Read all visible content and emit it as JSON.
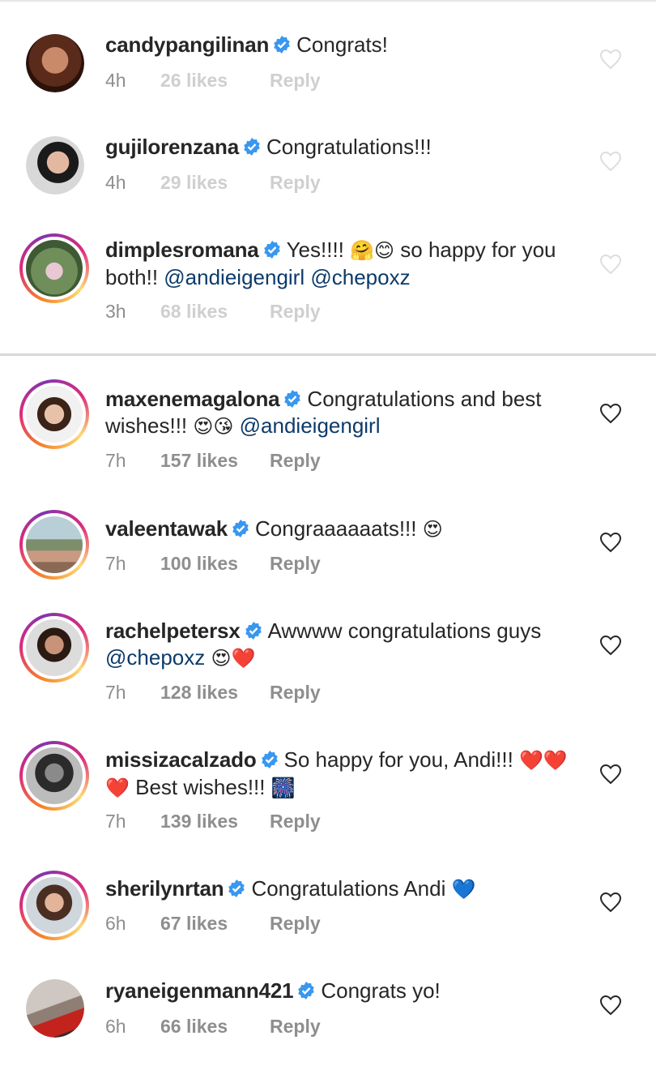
{
  "comments": [
    {
      "username": "candypangilinan",
      "text": "Congrats!",
      "time": "4h",
      "likes": "26 likes",
      "reply": "Reply"
    },
    {
      "username": "gujilorenzana",
      "text": "Congratulations!!!",
      "time": "4h",
      "likes": "29 likes",
      "reply": "Reply"
    },
    {
      "username": "dimplesromana",
      "text_1": "Yes!!!! ",
      "emoji_1": "🤗😊",
      "text_2": " so happy for you both!! ",
      "mention_1": "@andieigengirl",
      "mention_2": "@chepoxz",
      "time": "3h",
      "likes": "68 likes",
      "reply": "Reply"
    },
    {
      "username": "maxenemagalona",
      "text_1": "Congratulations and best wishes!!! ",
      "emoji_1": "😍😘",
      "mention_1": "@andieigengirl",
      "time": "7h",
      "likes": "157 likes",
      "reply": "Reply"
    },
    {
      "username": "valeentawak",
      "text_1": "Congraaaaaats!!! ",
      "emoji_1": "😍",
      "time": "7h",
      "likes": "100 likes",
      "reply": "Reply"
    },
    {
      "username": "rachelpetersx",
      "text_1": "Awwww congratulations guys ",
      "mention_1": "@chepoxz",
      "emoji_1": "😍❤️",
      "time": "7h",
      "likes": "128 likes",
      "reply": "Reply"
    },
    {
      "username": "missizacalzado",
      "text_1": "So happy for you, Andi!!! ",
      "emoji_1": "❤️❤️❤️",
      "text_2": " Best wishes!!! ",
      "emoji_2": "🎆",
      "time": "7h",
      "likes": "139 likes",
      "reply": "Reply"
    },
    {
      "username": "sherilynrtan",
      "text_1": "Congratulations Andi ",
      "emoji_1": "💙",
      "time": "6h",
      "likes": "67 likes",
      "reply": "Reply"
    },
    {
      "username": "ryaneigenmann421",
      "text_1": "Congrats yo!",
      "time": "6h",
      "likes": "66 likes",
      "reply": "Reply"
    }
  ],
  "colors": {
    "verified": "#3897f0",
    "mention": "#0c3b6a",
    "meta": "#8e8e8e",
    "ring_start": "#f58529",
    "ring_end": "#8134af"
  },
  "icons": {
    "verified": "verified-badge-icon",
    "like": "heart-outline-icon"
  }
}
